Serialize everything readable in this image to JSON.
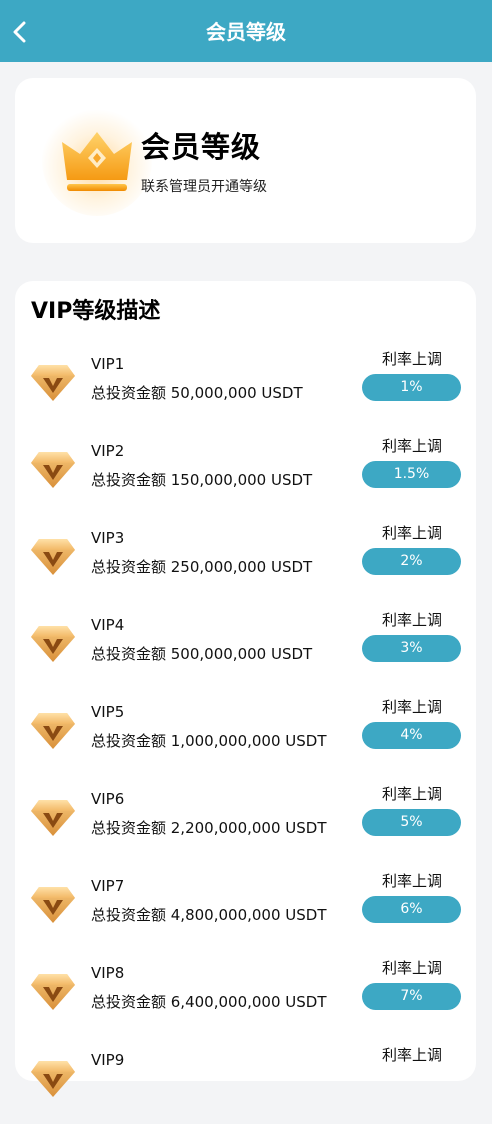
{
  "header": {
    "title": "会员等级",
    "back_icon": "chevron-left-icon"
  },
  "level_card": {
    "title": "会员等级",
    "subtitle": "联系管理员开通等级",
    "icon": "crown-icon"
  },
  "vip_section": {
    "title": "VIP等级描述",
    "rate_label": "利率上调",
    "rows": [
      {
        "name": "VIP1",
        "amount": "总投资金额 50,000,000 USDT",
        "rate": "1%"
      },
      {
        "name": "VIP2",
        "amount": "总投资金额 150,000,000 USDT",
        "rate": "1.5%"
      },
      {
        "name": "VIP3",
        "amount": "总投资金额 250,000,000 USDT",
        "rate": "2%"
      },
      {
        "name": "VIP4",
        "amount": "总投资金额 500,000,000 USDT",
        "rate": "3%"
      },
      {
        "name": "VIP5",
        "amount": "总投资金额 1,000,000,000 USDT",
        "rate": "4%"
      },
      {
        "name": "VIP6",
        "amount": "总投资金额 2,200,000,000 USDT",
        "rate": "5%"
      },
      {
        "name": "VIP7",
        "amount": "总投资金额 4,800,000,000 USDT",
        "rate": "6%"
      },
      {
        "name": "VIP8",
        "amount": "总投资金额 6,400,000,000 USDT",
        "rate": "7%"
      },
      {
        "name": "VIP9",
        "amount": "",
        "rate": ""
      }
    ]
  },
  "colors": {
    "accent": "#3da8c4",
    "background": "#f3f4f6",
    "gold": "#f5a623"
  }
}
